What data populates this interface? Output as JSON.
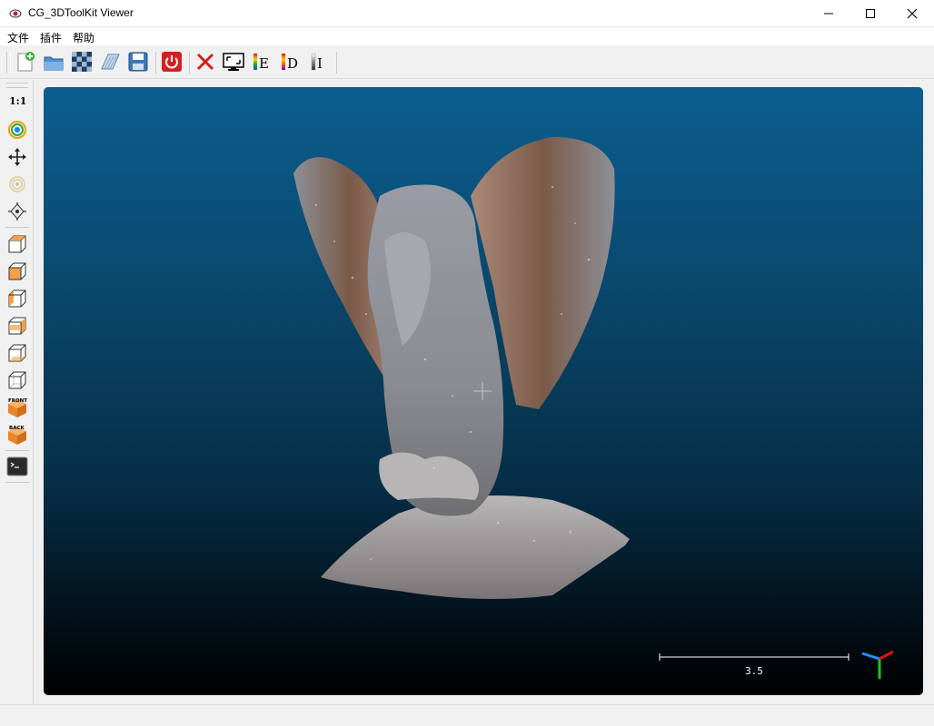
{
  "window": {
    "title": "CG_3DToolKit Viewer"
  },
  "menu": [
    {
      "label": "文件"
    },
    {
      "label": "插件"
    },
    {
      "label": "帮助"
    }
  ],
  "toolbar": {
    "icons": [
      "new-file-icon",
      "open-folder-icon",
      "checker-icon",
      "open-pointcloud-icon",
      "save-icon",
      "power-icon",
      "close-cloud-icon",
      "fullscreen-icon",
      "color-e-icon",
      "color-d-icon",
      "color-i-icon"
    ],
    "labels": {
      "e": "E",
      "d": "D",
      "i": "I"
    }
  },
  "sidebar": {
    "zoom_label": "1:1",
    "icons": [
      "zoom-1to1-icon",
      "orbit-icon",
      "pan-icon",
      "rotate-point-icon",
      "pick-center-icon",
      "view-top-icon",
      "view-front-cube-icon",
      "view-left-icon",
      "view-right-icon",
      "view-bottom-icon",
      "view-iso-icon",
      "view-front-icon",
      "view-back-icon",
      "console-icon"
    ],
    "front_label": "FRONT",
    "back_label": "BACK"
  },
  "viewport": {
    "scale_value": "3.5",
    "bg_top": "#0b5e8f",
    "bg_bottom": "#000000",
    "axes": {
      "x_color": "#e01010",
      "y_color": "#10d010",
      "z_color": "#2090ff"
    }
  }
}
